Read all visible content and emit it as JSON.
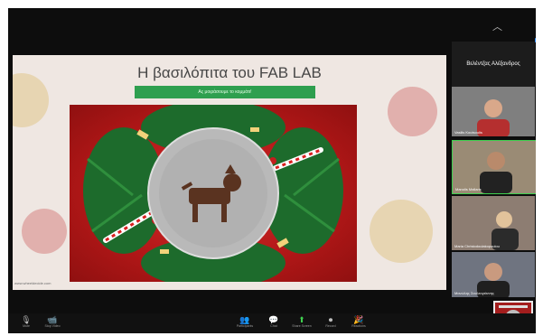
{
  "screen": {
    "minimize_glyph": "︿",
    "accent_color": "#2d8cff"
  },
  "slide": {
    "title": "Η βασιλόπιτα του FAB LAB",
    "button_text": "Ας μοιράσουμε το κομμάτι!",
    "caption": "www.wheeldecide.com",
    "dog_glyph": "🐕"
  },
  "participants": {
    "active_speaker": "Βελέντζας Αλέξανδρος",
    "tiles": [
      {
        "name": "Vasilis Koutsoulis"
      },
      {
        "name": "Manolis Mallaris"
      },
      {
        "name": "Maria Christodoulakopoulou"
      },
      {
        "name": "Μανώλης Σουλτογιάννης"
      }
    ],
    "more_glyph": "⋮"
  },
  "toolbar": {
    "left": [
      {
        "glyph": "🎙",
        "label": "Mute"
      },
      {
        "glyph": "📹",
        "label": "Stop Video"
      }
    ],
    "center": [
      {
        "glyph": "👥",
        "label": "Participants"
      },
      {
        "glyph": "💬",
        "label": "Chat"
      },
      {
        "glyph": "⬆",
        "label": "Share Screen"
      },
      {
        "glyph": "⏺",
        "label": "Record"
      },
      {
        "glyph": "🎉",
        "label": "Reactions"
      }
    ]
  }
}
